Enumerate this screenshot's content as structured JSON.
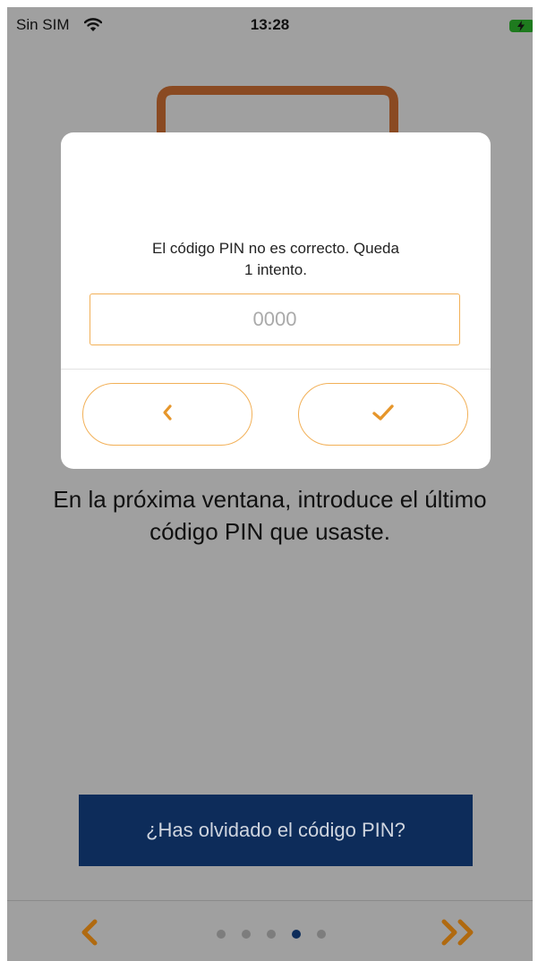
{
  "status_bar": {
    "carrier": "Sin SIM",
    "time": "13:28",
    "wifi_icon": "wifi-icon",
    "battery_icon": "battery-charging-icon"
  },
  "dialog": {
    "message_line1": "El código PIN no es correcto. Queda",
    "message_line2": "1 intento.",
    "pin_placeholder": "0000",
    "pin_value": "",
    "back_icon": "chevron-left-icon",
    "confirm_icon": "checkmark-icon"
  },
  "instruction": {
    "line1": "En la próxima ventana, introduce el último",
    "line2": "código PIN que usaste."
  },
  "forgot_button": {
    "label": "¿Has olvidado el código PIN?"
  },
  "pagination": {
    "total": 5,
    "current": 4,
    "prev_icon": "chevron-left-icon",
    "next_icon": "double-chevron-right-icon"
  },
  "colors": {
    "accent": "#e6962b",
    "primary": "#0d2c5a",
    "overlay": "#a0a0a0"
  }
}
